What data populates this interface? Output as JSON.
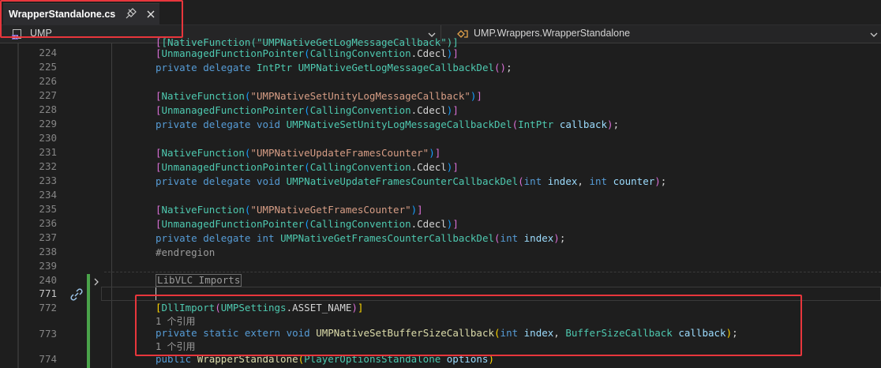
{
  "tab": {
    "title": "WrapperStandalone.cs"
  },
  "nav": {
    "project": "UMP",
    "class": "UMP.Wrappers.WrapperStandalone"
  },
  "colors": {
    "highlight": "#e8363c",
    "change_bar": "#4aa34a"
  },
  "icons": {
    "pin": "pin-icon",
    "close": "close-icon",
    "project": "csharp-project-icon",
    "class": "class-icon",
    "reference": "reference-link-icon",
    "fold": "chevron-right-icon"
  },
  "editor": {
    "line_numbers": [
      "224",
      "225",
      "226",
      "227",
      "228",
      "229",
      "230",
      "231",
      "232",
      "233",
      "234",
      "235",
      "236",
      "237",
      "238",
      "239",
      "240",
      "771",
      "772",
      "773",
      "774"
    ],
    "top_partial": "[NativeFunction(\"UMPNativeGetLogMessageCallback\")]",
    "l224": {
      "a": "UnmanagedFunctionPointer",
      "b": "CallingConvention",
      "c": ".Cdecl"
    },
    "l225": {
      "a": "private",
      "b": "delegate",
      "c": "IntPtr",
      "d": "UMPNativeGetLogMessageCallbackDel"
    },
    "l227": {
      "a": "NativeFunction",
      "b": "\"UMPNativeSetUnityLogMessageCallback\""
    },
    "l228": {
      "a": "UnmanagedFunctionPointer",
      "b": "CallingConvention",
      "c": ".Cdecl"
    },
    "l229": {
      "a": "private",
      "b": "delegate",
      "c": "void",
      "d": "UMPNativeSetUnityLogMessageCallbackDel",
      "e": "IntPtr",
      "f": "callback"
    },
    "l231": {
      "a": "NativeFunction",
      "b": "\"UMPNativeUpdateFramesCounter\""
    },
    "l232": {
      "a": "UnmanagedFunctionPointer",
      "b": "CallingConvention",
      "c": ".Cdecl"
    },
    "l233": {
      "a": "private",
      "b": "delegate",
      "c": "void",
      "d": "UMPNativeUpdateFramesCounterCallbackDel",
      "e": "int",
      "f": "index",
      "g": "int",
      "h": "counter"
    },
    "l235": {
      "a": "NativeFunction",
      "b": "\"UMPNativeGetFramesCounter\""
    },
    "l236": {
      "a": "UnmanagedFunctionPointer",
      "b": "CallingConvention",
      "c": ".Cdecl"
    },
    "l237": {
      "a": "private",
      "b": "delegate",
      "c": "int",
      "d": "UMPNativeGetFramesCounterCallbackDel",
      "e": "int",
      "f": "index"
    },
    "l238": "#endregion",
    "l240": "LibVLC Imports",
    "l772": {
      "a": "DllImport",
      "b": "UMPSettings",
      "c": ".ASSET_NAME"
    },
    "l773": {
      "a": "private",
      "b": "static",
      "c": "extern",
      "d": "void",
      "e": "UMPNativeSetBufferSizeCallback",
      "f": "int",
      "g": "index",
      "h": "BufferSizeCallback",
      "i": "callback"
    },
    "l774": {
      "a": "public",
      "b": "WrapperStandalone",
      "c": "PlayerOptionsStandalone",
      "d": "options"
    },
    "codelens_1": "1 个引用",
    "codelens_2": "1 个引用"
  }
}
